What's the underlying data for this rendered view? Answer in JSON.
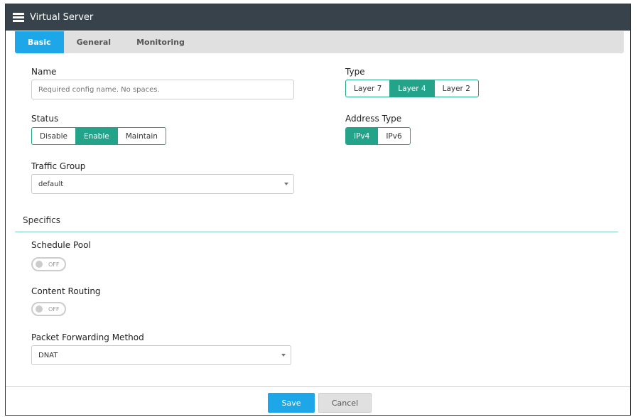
{
  "header": {
    "title": "Virtual Server",
    "icon": "server-icon"
  },
  "tabs": [
    {
      "label": "Basic",
      "active": true
    },
    {
      "label": "General"
    },
    {
      "label": "Monitoring"
    }
  ],
  "form": {
    "name": {
      "label": "Name",
      "value": "",
      "placeholder": "Required config name. No spaces."
    },
    "type": {
      "label": "Type",
      "options": [
        "Layer 7",
        "Layer 4",
        "Layer 2"
      ],
      "selected": "Layer 4"
    },
    "status": {
      "label": "Status",
      "options": [
        "Disable",
        "Enable",
        "Maintain"
      ],
      "selected": "Enable"
    },
    "address_type": {
      "label": "Address Type",
      "options": [
        "IPv4",
        "IPv6"
      ],
      "selected": "IPv4"
    },
    "traffic_group": {
      "label": "Traffic Group",
      "value": "default"
    }
  },
  "specifics": {
    "title": "Specifics",
    "schedule_pool": {
      "label": "Schedule Pool",
      "state": "OFF"
    },
    "content_routing": {
      "label": "Content Routing",
      "state": "OFF"
    },
    "packet_forwarding": {
      "label": "Packet Forwarding Method",
      "value": "DNAT"
    }
  },
  "footer": {
    "save": "Save",
    "cancel": "Cancel"
  },
  "colors": {
    "header": "#37424a",
    "tab_active": "#1ea7e8",
    "accent": "#23a38a",
    "save": "#1ea7e8"
  }
}
